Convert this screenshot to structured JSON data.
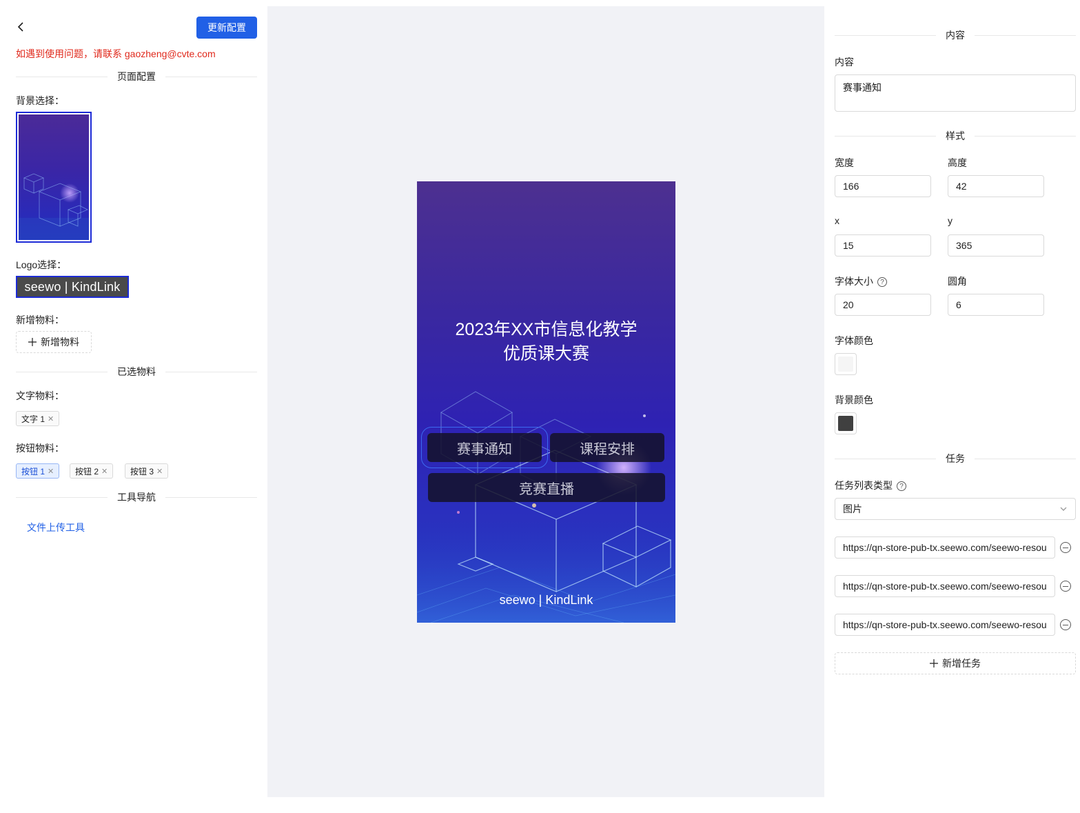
{
  "left": {
    "update_button": "更新配置",
    "contact_notice": "如遇到使用问题，请联系 gaozheng@cvte.com",
    "page_config_title": "页面配置",
    "background_label": "背景选择：",
    "logo_label": "Logo选择：",
    "logo_text": "seewo | KindLink",
    "new_material_label": "新增物料：",
    "new_material_button": "新增物料",
    "selected_title": "已选物料",
    "text_material_label": "文字物料：",
    "text_tags": [
      {
        "label": "文字 1"
      }
    ],
    "button_material_label": "按钮物料：",
    "button_tags": [
      {
        "label": "按钮 1"
      },
      {
        "label": "按钮 2"
      },
      {
        "label": "按钮 3"
      }
    ],
    "tool_nav_title": "工具导航",
    "tool_link": "文件上传工具"
  },
  "preview": {
    "title_line1": "2023年XX市信息化教学",
    "title_line2": "优质课大赛",
    "buttons": [
      {
        "label": "赛事通知"
      },
      {
        "label": "课程安排"
      },
      {
        "label": "竞赛直播"
      }
    ],
    "logo_text": "seewo | KindLink"
  },
  "right": {
    "content_section": "内容",
    "content_label": "内容",
    "content_value": "赛事通知",
    "style_section": "样式",
    "width_label": "宽度",
    "width_value": "166",
    "height_label": "高度",
    "height_value": "42",
    "x_label": "x",
    "x_value": "15",
    "y_label": "y",
    "y_value": "365",
    "font_size_label": "字体大小",
    "font_size_value": "20",
    "radius_label": "圆角",
    "radius_value": "6",
    "font_color_label": "字体颜色",
    "font_color": "#f5f5f5",
    "bg_color_label": "背景颜色",
    "bg_color": "#404040",
    "task_section": "任务",
    "task_type_label": "任务列表类型",
    "task_type_value": "图片",
    "task_urls": [
      "https://qn-store-pub-tx.seewo.com/seewo-resou",
      "https://qn-store-pub-tx.seewo.com/seewo-resou",
      "https://qn-store-pub-tx.seewo.com/seewo-resou"
    ],
    "add_task_button": "新增任务"
  },
  "colors": {
    "primary": "#2160e6",
    "notice_red": "#e0281b",
    "preview_bg_top": "#4d3090",
    "preview_bg_bottom": "#2340c3"
  }
}
